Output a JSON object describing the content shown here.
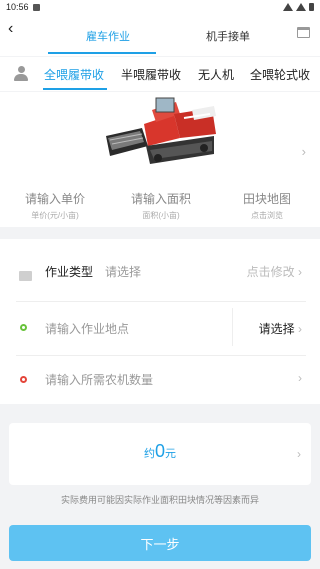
{
  "status_bar": {
    "time": "10:56"
  },
  "nav": {
    "back_icon": "‹",
    "tabs": [
      {
        "label": "雇车作业"
      },
      {
        "label": "机手接单"
      }
    ]
  },
  "categories": [
    {
      "label": "全喂履带收"
    },
    {
      "label": "半喂履带收"
    },
    {
      "label": "无人机"
    },
    {
      "label": "全喂轮式收"
    }
  ],
  "machine": {
    "stats": [
      {
        "main": "请输入单价",
        "sub": "单价(元/小亩)"
      },
      {
        "main": "请输入面积",
        "sub": "面积(小亩)"
      },
      {
        "main": "田块地图",
        "sub": "点击浏览"
      }
    ]
  },
  "form": {
    "work_type": {
      "label": "作业类型",
      "placeholder": "请选择",
      "action": "点击修改"
    },
    "location": {
      "placeholder": "请输入作业地点",
      "action": "请选择"
    },
    "quantity": {
      "placeholder": "请输入所需农机数量"
    }
  },
  "price": {
    "prefix": "约",
    "value": "0",
    "unit": "元"
  },
  "note": "实际费用可能因实际作业面积田块情况等因素而异",
  "next_button": "下一步",
  "arrow": "›",
  "colors": {
    "accent": "#1ea0e6",
    "button": "#5ec2f2",
    "green_dot": "#67c23a",
    "red_dot": "#e4453a",
    "harvester_red": "#d8362c"
  }
}
